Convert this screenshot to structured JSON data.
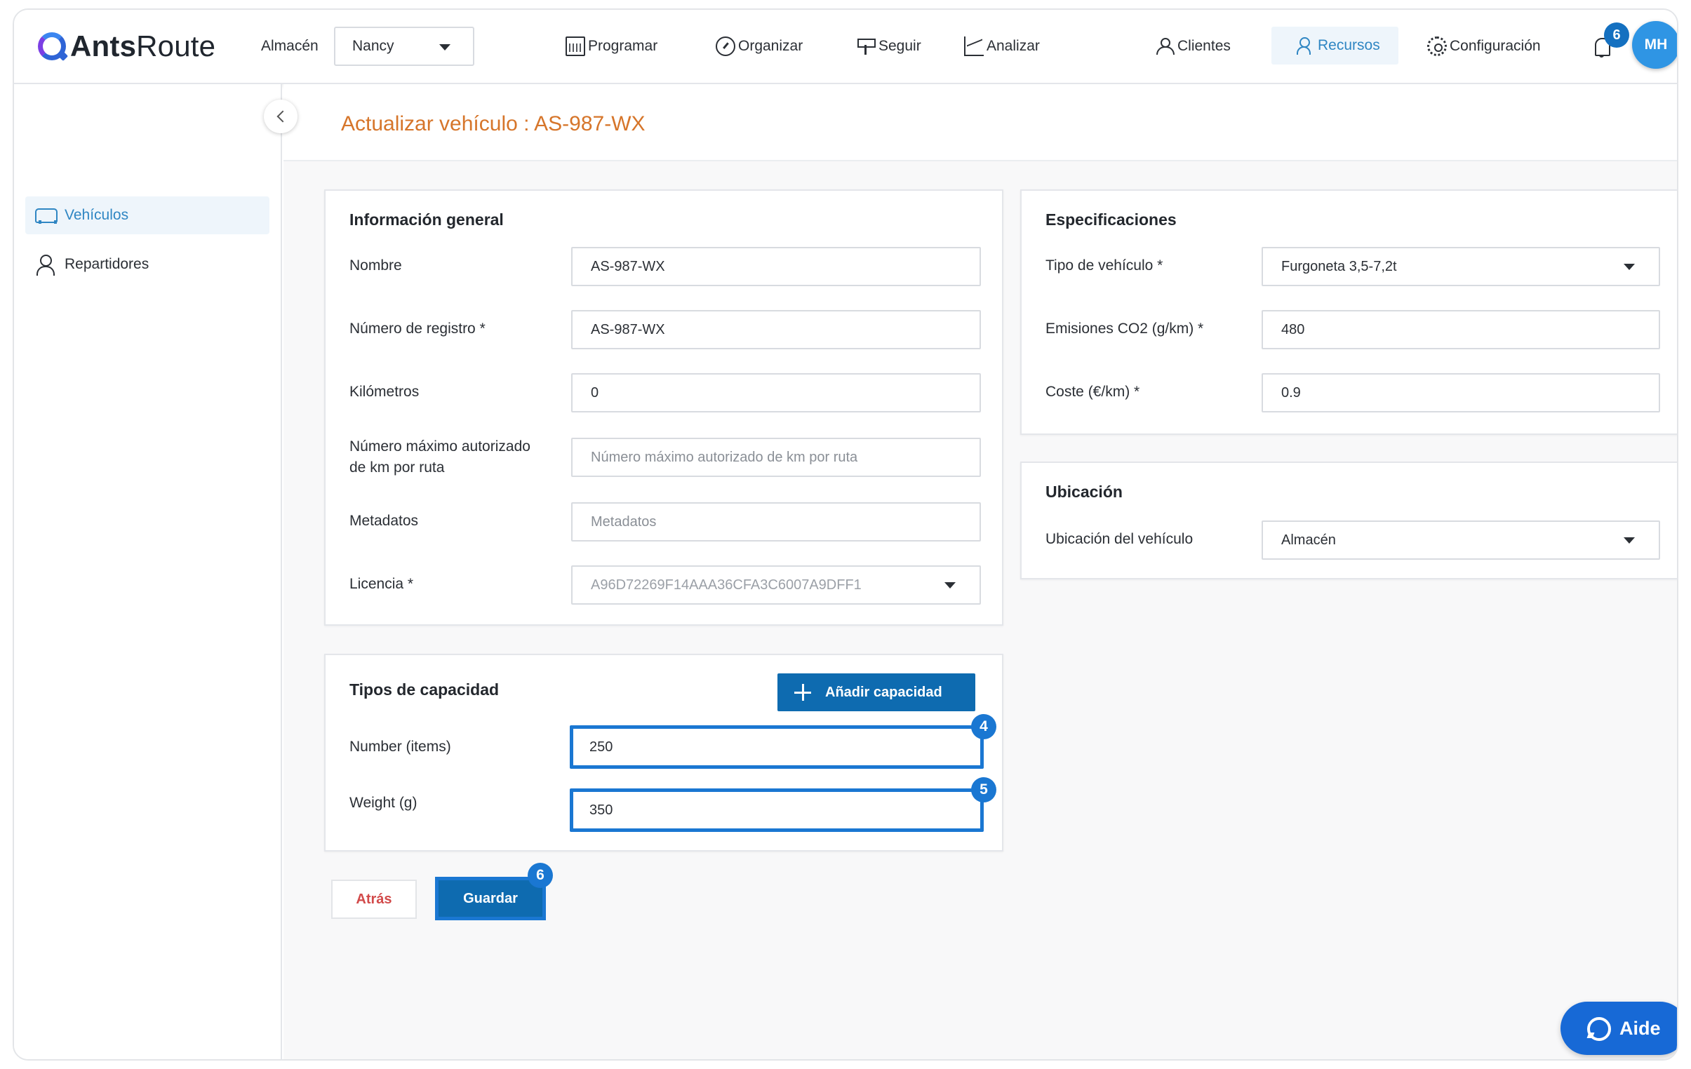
{
  "app": {
    "logo_bold": "Ants",
    "logo_light": "Route"
  },
  "header": {
    "warehouse_label": "Almacén",
    "warehouse_value": "Nancy",
    "nav": [
      {
        "label": "Programar",
        "icon": "calendar-icon"
      },
      {
        "label": "Organizar",
        "icon": "gauge-icon"
      },
      {
        "label": "Seguir",
        "icon": "signpost-icon"
      },
      {
        "label": "Analizar",
        "icon": "chart-icon"
      },
      {
        "label": "Clientes",
        "icon": "users-icon"
      },
      {
        "label": "Recursos",
        "icon": "user-gear-icon",
        "active": true
      },
      {
        "label": "Configuración",
        "icon": "gear-icon"
      }
    ],
    "notifications_count": "6",
    "avatar_initials": "MH"
  },
  "sidebar": {
    "items": [
      {
        "label": "Vehículos",
        "icon": "van-icon",
        "active": true
      },
      {
        "label": "Repartidores",
        "icon": "user-icon"
      }
    ]
  },
  "page": {
    "title": "Actualizar vehículo : AS-987-WX"
  },
  "general": {
    "title": "Información general",
    "name_label": "Nombre",
    "name_value": "AS-987-WX",
    "registration_label": "Número de registro *",
    "registration_value": "AS-987-WX",
    "km_label": "Kilómetros",
    "km_value": "0",
    "max_km_label_line1": "Número máximo autorizado",
    "max_km_label_line2": "de km por ruta",
    "max_km_placeholder": "Número máximo autorizado de km por ruta",
    "metadata_label": "Metadatos",
    "metadata_placeholder": "Metadatos",
    "license_label": "Licencia *",
    "license_value": "A96D72269F14AAA36CFA3C6007A9DFF1"
  },
  "specs": {
    "title": "Especificaciones",
    "type_label": "Tipo de vehículo *",
    "type_value": "Furgoneta 3,5-7,2t",
    "co2_label": "Emisiones CO2 (g/km) *",
    "co2_value": "480",
    "cost_label": "Coste (€/km) *",
    "cost_value": "0.9"
  },
  "location": {
    "title": "Ubicación",
    "vehicle_location_label": "Ubicación del vehículo",
    "vehicle_location_value": "Almacén"
  },
  "capacity": {
    "title": "Tipos de capacidad",
    "add_button": "Añadir capacidad",
    "items": [
      {
        "label": "Number (items)",
        "value": "250",
        "step": "4"
      },
      {
        "label": "Weight (g)",
        "value": "350",
        "step": "5"
      }
    ]
  },
  "actions": {
    "back": "Atrás",
    "save": "Guardar",
    "save_step": "6"
  },
  "help": {
    "label": "Aide"
  },
  "colors": {
    "accent": "#2f86c3",
    "primary": "#0e6bb0",
    "title": "#d6752a",
    "highlight": "#1a77d2"
  }
}
